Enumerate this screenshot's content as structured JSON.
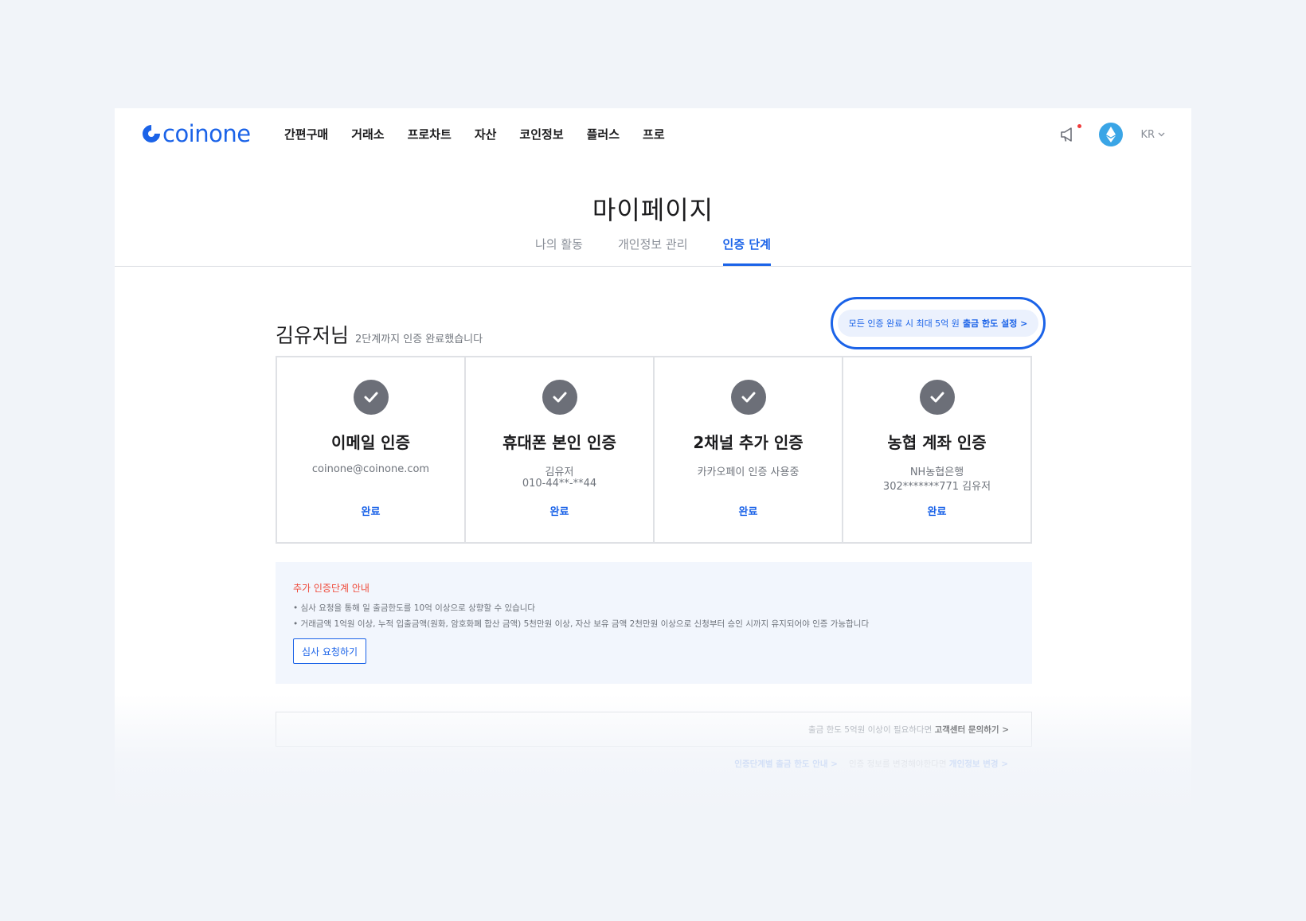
{
  "header": {
    "logo_text": "coinone",
    "nav": [
      "간편구매",
      "거래소",
      "프로차트",
      "자산",
      "코인정보",
      "플러스",
      "프로"
    ],
    "lang": "KR",
    "icons": [
      "megaphone-icon",
      "ethereum-avatar-icon",
      "chevron-down-icon"
    ]
  },
  "page": {
    "title": "마이페이지",
    "tabs": [
      {
        "label": "나의 활동",
        "active": false
      },
      {
        "label": "개인정보 관리",
        "active": false
      },
      {
        "label": "인증 단계",
        "active": true
      }
    ]
  },
  "greeting": {
    "name": "김유저님",
    "sub": "2단계까지 인증 완료했습니다"
  },
  "limit_banner": {
    "text": "모든 인증 완료 시 최대 5억 원",
    "link": "출금 한도 설정 >"
  },
  "cards": [
    {
      "title": "이메일 인증",
      "d1": "coinone@coinone.com",
      "d2": "",
      "status": "완료"
    },
    {
      "title": "휴대폰 본인 인증",
      "d1": "김유저",
      "d2": "010-44**-**44",
      "status": "완료"
    },
    {
      "title": "2채널 추가 인증",
      "d1": "카카오페이 인증 사용중",
      "d2": "",
      "status": "완료"
    },
    {
      "title": "농협 계좌 인증",
      "d1": "NH농협은행",
      "d2": "302*******771 김유저",
      "status": "완료"
    }
  ],
  "notice": {
    "title": "추가 인증단계 안내",
    "lines": [
      "• 심사 요청을 통해 일 출금한도를 10억 이상으로 상향할 수 있습니다",
      "• 거래금액 1억원 이상, 누적 입출금액(원화, 암호화폐 합산 금액) 5천만원 이상, 자산 보유 금액 2천만원 이상으로 신청부터 승인 시까지 유지되어야 인증 가능합니다"
    ],
    "button": "심사 요청하기"
  },
  "support": {
    "text": "출금 한도 5억원 이상이 필요하다면",
    "link": "고객센터 문의하기 >"
  },
  "footer_links": {
    "guide": "인증단계별 출금 한도 안내 >",
    "change_text": "인증 정보를 변경해야한다면",
    "change_link": "개인정보 변경 >"
  },
  "colors": {
    "brand": "#1b63e8",
    "notice_red": "#ef4b3b",
    "check_gray": "#6c6f78",
    "background": "#f1f4f9"
  }
}
